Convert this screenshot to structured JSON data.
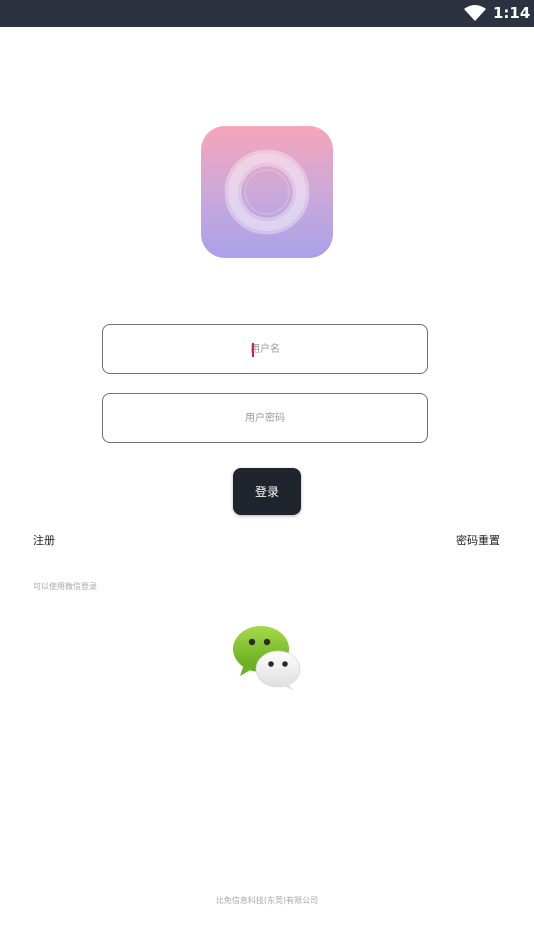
{
  "status_bar": {
    "time": "1:14",
    "wifi_icon": "wifi-icon",
    "background": "#2d3240"
  },
  "logo": {
    "icon": "app-logo-ring-icon",
    "gradient_top": "#f6a6b9",
    "gradient_bottom": "#a9a1e8"
  },
  "form": {
    "username_placeholder": "用户名",
    "username_value": "",
    "password_placeholder": "用户密码",
    "password_value": "",
    "login_label": "登录",
    "caret_color": "#d81b60"
  },
  "links": {
    "register": "注册",
    "reset_password": "密码重置"
  },
  "wechat": {
    "hint": "可以使用微信登录",
    "icon": "wechat-icon"
  },
  "footer": {
    "company": "比免信息科技(东莞)有限公司"
  }
}
